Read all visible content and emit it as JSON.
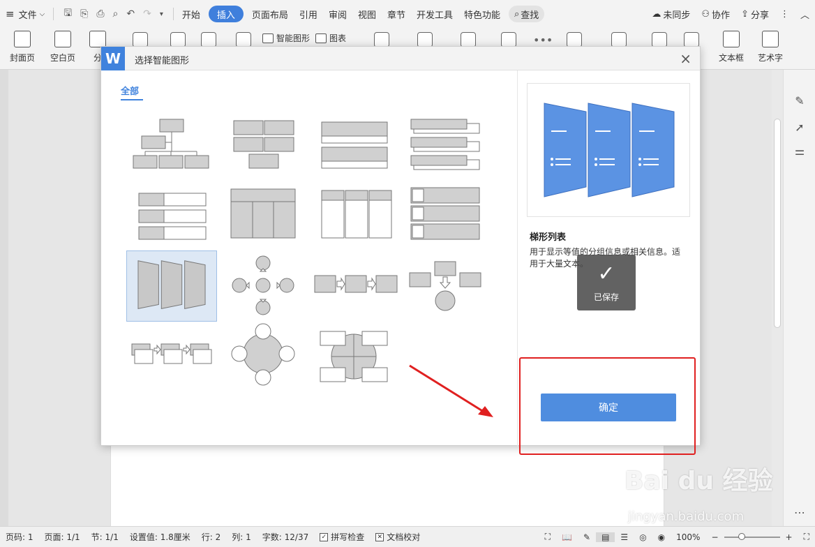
{
  "menubar": {
    "file_label": "文件",
    "tabs": [
      "开始",
      "插入",
      "页面布局",
      "引用",
      "审阅",
      "视图",
      "章节",
      "开发工具",
      "特色功能"
    ],
    "search_label": "查找",
    "sync_label": "未同步",
    "collab_label": "协作",
    "share_label": "分享"
  },
  "ribbon": {
    "cover_label": "封面页",
    "blank_label": "空白页",
    "split_label": "分",
    "smartart_label": "智能图形",
    "chart_label": "图表",
    "textbox_label": "文本框",
    "wordart_label": "艺术字"
  },
  "dialog": {
    "logo": "W",
    "title": "选择智能图形",
    "close": "×",
    "tab_all": "全部",
    "selected_name": "梯形列表",
    "selected_desc": "用于显示等值的分组信息或相关信息。适用于大量文本。",
    "confirm_label": "确定",
    "saved_toast": "已保存"
  },
  "statusbar": {
    "page_num": "页码: 1",
    "pages": "页面: 1/1",
    "section": "节: 1/1",
    "setting": "设置值: 1.8厘米",
    "row": "行: 2",
    "col": "列: 1",
    "wordcount": "字数: 12/37",
    "spellcheck": "拼写检查",
    "doccheck": "文档校对",
    "zoom": "100%"
  },
  "watermark": {
    "text": "Bai du 经验",
    "url": "jingyan.baidu.com"
  },
  "colors": {
    "accent": "#3f82dd",
    "preview_fill": "#5b93e3",
    "highlight": "#e02020"
  }
}
